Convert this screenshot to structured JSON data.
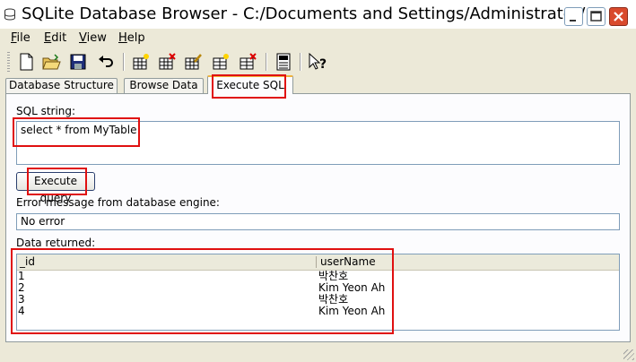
{
  "window": {
    "title": "SQLite Database Browser - C:/Documents and Settings/Administrator/..."
  },
  "menu": [
    {
      "label": "File",
      "underline": "F",
      "rest": "ile"
    },
    {
      "label": "Edit",
      "underline": "E",
      "rest": "dit"
    },
    {
      "label": "View",
      "underline": "V",
      "rest": "iew"
    },
    {
      "label": "Help",
      "underline": "H",
      "rest": "elp"
    }
  ],
  "toolbar": {
    "icons": [
      "new-database-icon",
      "open-database-icon",
      "save-icon",
      "undo-icon",
      "create-table-icon",
      "delete-table-icon",
      "modify-table-icon",
      "create-index-icon",
      "delete-index-icon",
      "sql-log-icon",
      "whats-this-icon"
    ]
  },
  "tabs": [
    {
      "label": "Database Structure"
    },
    {
      "label": "Browse Data"
    },
    {
      "label": "Execute SQL",
      "active": true
    }
  ],
  "execute_sql": {
    "sql_label": "SQL string:",
    "sql_value": "select * from MyTable",
    "execute_button": "Execute query",
    "error_label": "Error message from database engine:",
    "error_value": "No error",
    "data_label": "Data returned:",
    "columns": [
      "_id",
      "userName"
    ],
    "rows": [
      [
        "1",
        "박찬호"
      ],
      [
        "2",
        "Kim Yeon Ah"
      ],
      [
        "3",
        "박찬호"
      ],
      [
        "4",
        "Kim Yeon Ah"
      ]
    ]
  },
  "colors": {
    "annotation": "#e01010",
    "active_tab_accent": "#f0b33c",
    "window_bg": "#ece9d8"
  }
}
